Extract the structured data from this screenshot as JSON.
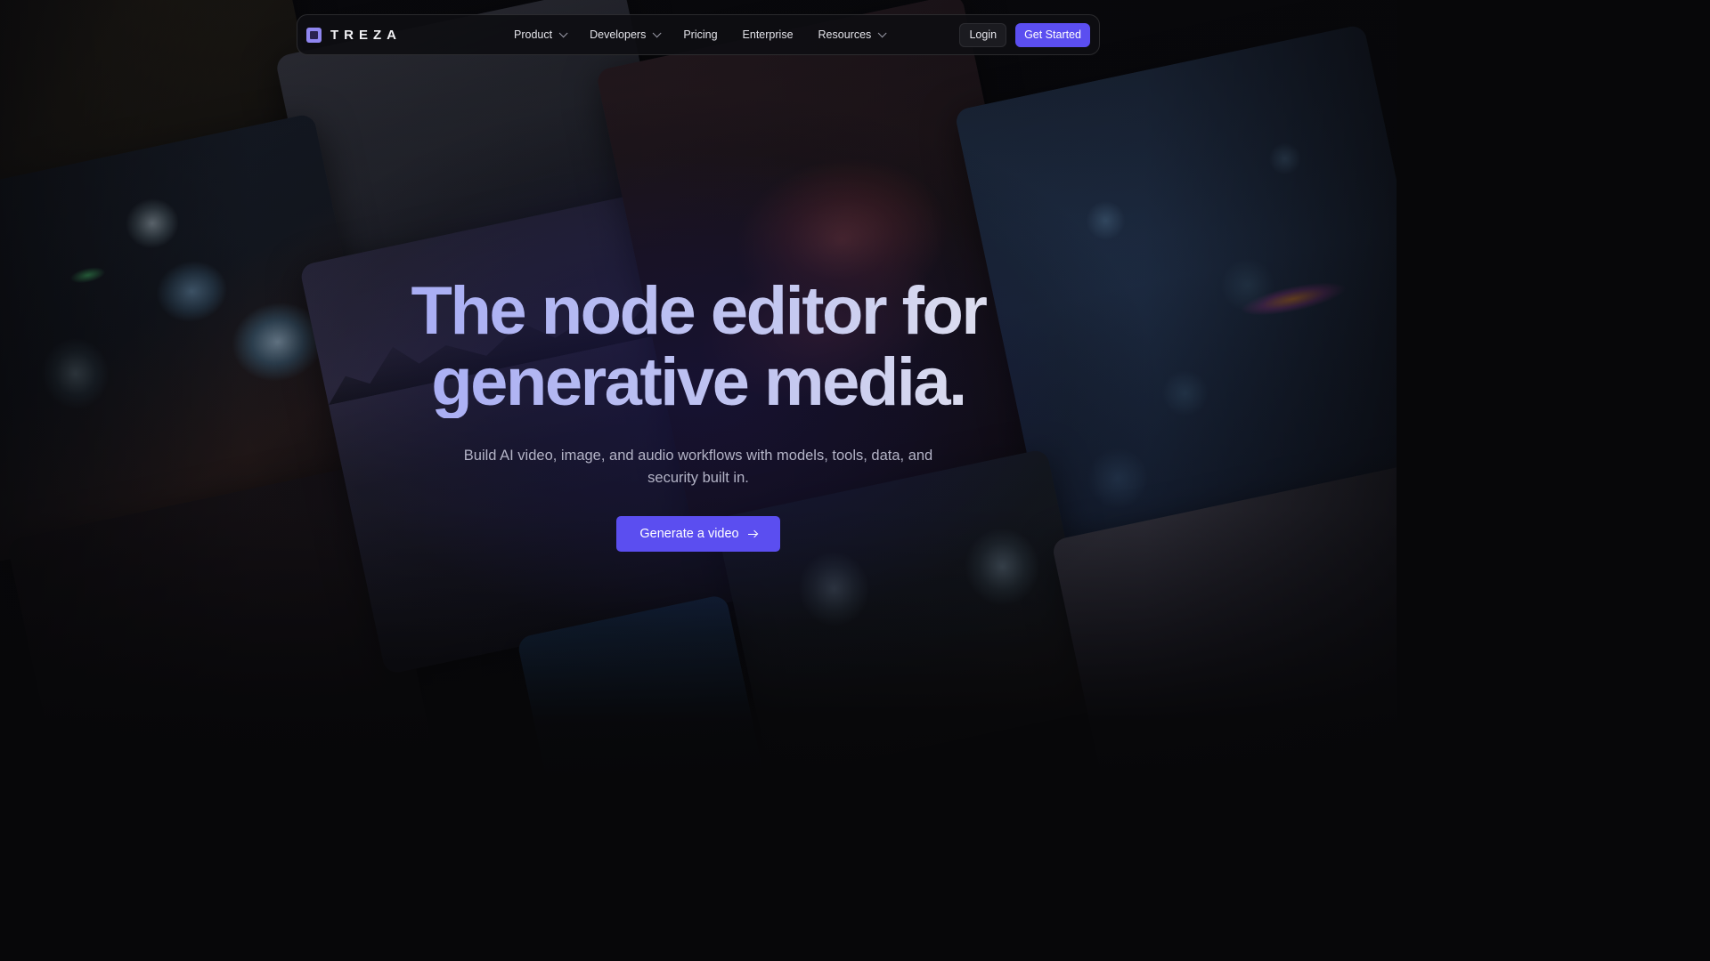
{
  "brand": {
    "name": "TREZA",
    "logo_icon": "square-logo-icon",
    "accent": "#5b4ef0"
  },
  "nav": {
    "items": [
      {
        "label": "Product",
        "has_dropdown": true
      },
      {
        "label": "Developers",
        "has_dropdown": true
      },
      {
        "label": "Pricing",
        "has_dropdown": false
      },
      {
        "label": "Enterprise",
        "has_dropdown": false
      },
      {
        "label": "Resources",
        "has_dropdown": true
      }
    ],
    "login_label": "Login",
    "get_started_label": "Get Started"
  },
  "hero": {
    "headline_line1": "The node editor for",
    "headline_line2": "generative media.",
    "subtitle": "Build AI video, image, and audio workflows with models, tools, data, and security built in.",
    "cta_label": "Generate a video",
    "cta_icon": "arrow-right-icon"
  }
}
